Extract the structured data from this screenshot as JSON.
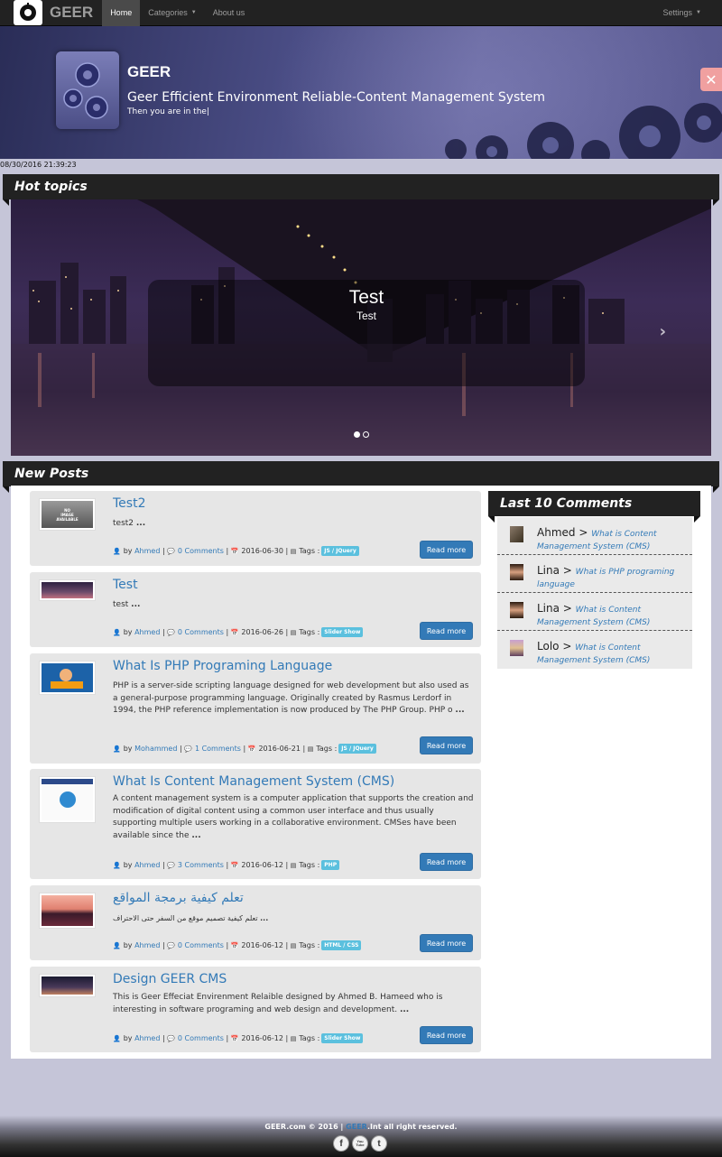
{
  "nav": {
    "brand": "GEER",
    "items": [
      {
        "label": "Home",
        "active": true
      },
      {
        "label": "Categories",
        "dropdown": true
      },
      {
        "label": "About us"
      }
    ],
    "settings": "Settings"
  },
  "banner": {
    "title": "GEER",
    "subtitle": "Geer Efficient Environment Reliable-Content Management System",
    "typing": "Then you are in the"
  },
  "timestamp": "08/30/2016 21:39:23",
  "hot_topics": {
    "heading": "Hot topics",
    "slide_title": "Test",
    "slide_text": "Test",
    "active_index": 0,
    "slides_count": 2
  },
  "new_posts": {
    "heading": "New Posts",
    "read_more": "Read more",
    "by": "by",
    "tags_label": "Tags :",
    "posts": [
      {
        "title": "Test2",
        "excerpt": "test2",
        "author": "Ahmed",
        "comments": "0 Comments",
        "date": "2016-06-30",
        "tag": "JS / JQuery"
      },
      {
        "title": "Test",
        "excerpt": "test",
        "author": "Ahmed",
        "comments": "0 Comments",
        "date": "2016-06-26",
        "tag": "Slider Show"
      },
      {
        "title": "What Is PHP Programing Language",
        "excerpt": "PHP is a server-side scripting language designed for web development but also used as a general-purpose programming language. Originally created by Rasmus Lerdorf in 1994,  the PHP reference implementation is now produced by The PHP Group. PHP o",
        "author": "Mohammed",
        "comments": "1 Comments",
        "date": "2016-06-21",
        "tag": "JS / JQuery"
      },
      {
        "title": "What Is Content Management System (CMS)",
        "excerpt": "A content management system is a computer application that supports the creation and modification of digital content using a common user interface and thus usually supporting multiple users working in a collaborative environment. CMSes have been available since the",
        "author": "Ahmed",
        "comments": "3 Comments",
        "date": "2016-06-12",
        "tag": "PHP"
      },
      {
        "title": "تعلم كيفية برمجة المواقع",
        "excerpt": "تعلم كيفية تصميم موقع من السفر حتى الاحتراف",
        "author": "Ahmed",
        "comments": "0 Comments",
        "date": "2016-06-12",
        "tag": "HTML / CSS"
      },
      {
        "title": "Design GEER CMS",
        "excerpt": "This is Geer Effeciat Envirenment Relaible designed by Ahmed B. Hameed who is interesting in software programing and web design and development.",
        "author": "Ahmed",
        "comments": "0 Comments",
        "date": "2016-06-12",
        "tag": "Slider Show"
      }
    ]
  },
  "last_comments": {
    "heading": "Last 10 Comments",
    "items": [
      {
        "name": "Ahmed",
        "post": "What is Content Management System (CMS)"
      },
      {
        "name": "Lina",
        "post": "What is PHP programing language"
      },
      {
        "name": "Lina",
        "post": "What is Content Management System (CMS)"
      },
      {
        "name": "Lolo",
        "post": "What is Content Management System (CMS)"
      }
    ]
  },
  "footer": {
    "site": "GEER.com © 2016 |",
    "brand": "GEER",
    "rest": ".Int all right reserved.",
    "social": [
      "f",
      "You Tube",
      "t"
    ]
  },
  "thumb_placeholder": [
    "NO",
    "IMAGE",
    "AVAILABLE"
  ],
  "colors": {
    "nav_bg": "#222222",
    "link": "#337ab7",
    "button": "#337ab7",
    "tag": "#5bc0de",
    "page_bg": "#c5c5d8",
    "post_bg": "#e6e6e6"
  }
}
